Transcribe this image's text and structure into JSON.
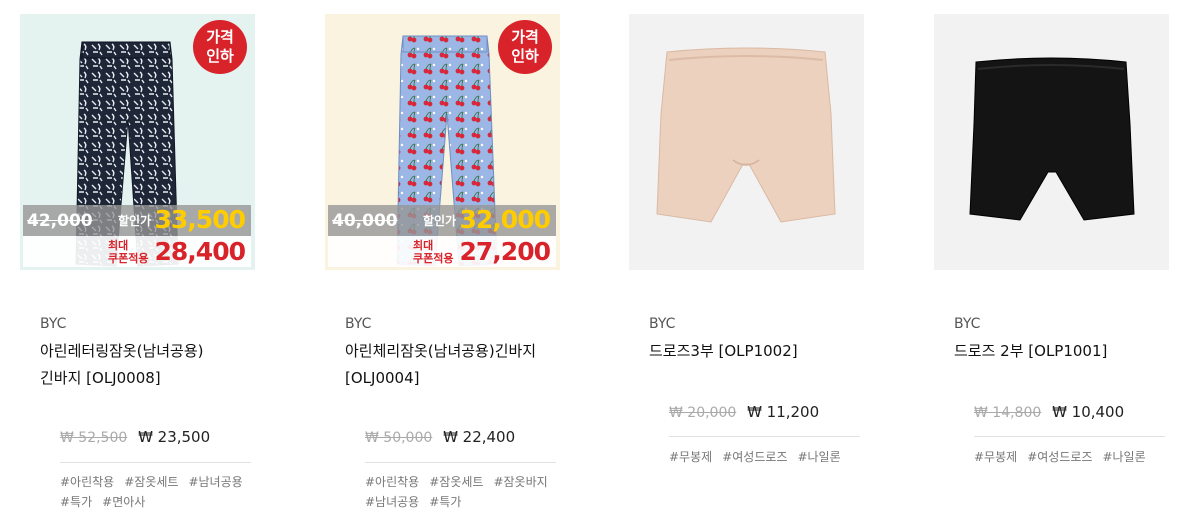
{
  "products": [
    {
      "brand": "BYC",
      "name_line1": "아린레터링잠옷(남녀공용)",
      "name_line2": "긴바지 [OLJ0008]",
      "badge_line1": "가격",
      "badge_line2": "인하",
      "overlay_original": "42,000",
      "overlay_sale_label": "할인가",
      "overlay_sale": "33,500",
      "overlay_coupon_label1": "최대",
      "overlay_coupon_label2": "쿠폰적용",
      "overlay_coupon": "28,400",
      "price_original": "₩ 52,500",
      "price_sale": "₩ 23,500",
      "tags": [
        "#아린착용",
        "#잠옷세트",
        "#남녀공용",
        "#특가",
        "#면아사"
      ],
      "bg_color": "#e4f2f0",
      "pattern": "navy"
    },
    {
      "brand": "BYC",
      "name_line1": "아린체리잠옷(남녀공용)긴바지",
      "name_line2": "[OLJ0004]",
      "badge_line1": "가격",
      "badge_line2": "인하",
      "overlay_original": "40,000",
      "overlay_sale_label": "할인가",
      "overlay_sale": "32,000",
      "overlay_coupon_label1": "최대",
      "overlay_coupon_label2": "쿠폰적용",
      "overlay_coupon": "27,200",
      "price_original": "₩ 50,000",
      "price_sale": "₩ 22,400",
      "tags": [
        "#아린착용",
        "#잠옷세트",
        "#잠옷바지",
        "#남녀공용",
        "#특가"
      ],
      "bg_color": "#faf3df",
      "pattern": "cherry"
    },
    {
      "brand": "BYC",
      "name_line1": "드로즈3부 [OLP1002]",
      "price_original": "₩ 20,000",
      "price_sale": "₩ 11,200",
      "tags": [
        "#무봉제",
        "#여성드로즈",
        "#나일론"
      ],
      "bg_color": "#f2f2f2",
      "garment_color": "#ecd1be"
    },
    {
      "brand": "BYC",
      "name_line1": "드로즈 2부 [OLP1001]",
      "price_original": "₩ 14,800",
      "price_sale": "₩ 10,400",
      "tags": [
        "#무봉제",
        "#여성드로즈",
        "#나일론"
      ],
      "bg_color": "#f2f2f2",
      "garment_color": "#141414"
    }
  ]
}
